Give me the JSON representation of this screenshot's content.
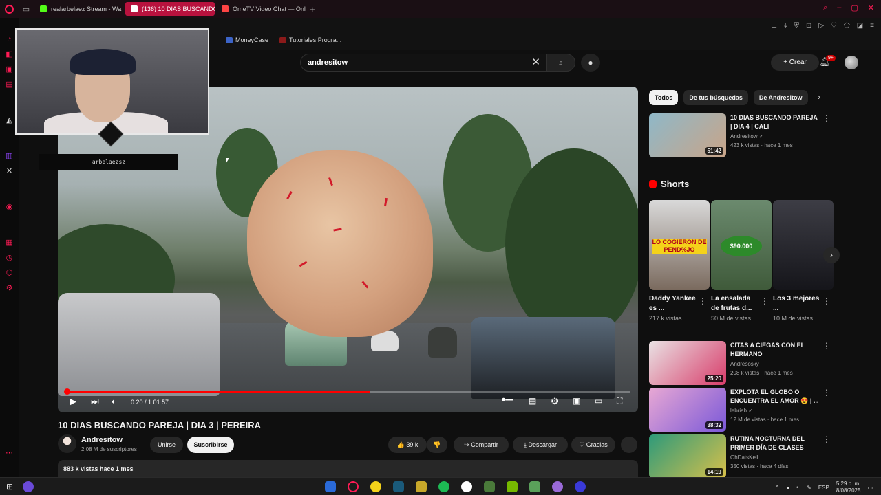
{
  "tabs": [
    {
      "title": "realarbelaez Stream - Wa",
      "color": "#53fc18"
    },
    {
      "title": "(136) 10 DIAS BUSCANDO",
      "color": "#ff0000"
    },
    {
      "title": "OmeTV Video Chat — Onl",
      "color": "#ff4444"
    }
  ],
  "new_tab": "+",
  "bookmarks": [
    {
      "label": "MoneyCase",
      "color": "#3c64c8"
    },
    {
      "label": "Tutoriales Progra...",
      "color": "#8b1a1a"
    }
  ],
  "search": {
    "query": "andresitow",
    "clear": "✕",
    "search_icon": "⌕",
    "mic_icon": "🎤"
  },
  "header": {
    "crear": "+ Crear",
    "notif_count": "9+"
  },
  "player": {
    "time": "0:20 / 1:01:57",
    "progress": 0.54
  },
  "video": {
    "title": "10 DIAS BUSCANDO PAREJA | DIA 3 | PEREIRA",
    "channel": "Andresitow",
    "subs": "2.08 M de suscriptores",
    "join": "Unirse",
    "subscribe": "Suscribirse",
    "likes": "👍 39 k",
    "dislike": "👎",
    "share": "↪ Compartir",
    "download": "⤓ Descargar",
    "thanks": "♡ Gracias",
    "more": "···",
    "views": "883 k vistas  hace 1 mes"
  },
  "webcam": {
    "label": "arbelaezsz"
  },
  "chips": [
    "Todos",
    "De tus búsquedas",
    "De Andresitow"
  ],
  "chips_next": "›",
  "recommended_top": {
    "title": "10 DIAS BUSCANDO PAREJA | DIA 4 | CALI",
    "channel": "Andresitow ✓",
    "meta": "423 k vistas · hace 1 mes",
    "duration": "51:42"
  },
  "shorts": {
    "heading": "Shorts",
    "items": [
      {
        "title": "Daddy Yankee es ...",
        "views": "217 k vistas",
        "thumb_text": "LO COGIERON DE PEND%JO"
      },
      {
        "title": "La ensalada de frutas d...",
        "views": "50 M de vistas",
        "thumb_text": "$90.000"
      },
      {
        "title": "Los 3 mejores ...",
        "views": "10 M de vistas",
        "thumb_text": ""
      }
    ],
    "next": "›"
  },
  "recommended": [
    {
      "title": "CITAS A CIEGAS CON EL HERMANO",
      "channel": "Andresosky",
      "meta": "208 k vistas · hace 1 mes",
      "duration": "25:20",
      "color": "#d83c6a"
    },
    {
      "title": "EXPLOTA EL GLOBO O ENCUENTRA EL AMOR 😍 | ...",
      "channel": "lebriah ✓",
      "meta": "12 M de vistas · hace 1 mes",
      "duration": "38:32",
      "color": "#7a58d8"
    },
    {
      "title": "RUTINA NOCTURNA DEL PRIMER DÍA DE CLASES",
      "channel": "OhDatsKell",
      "meta": "350 vistas · hace 4 días",
      "duration": "14:19",
      "color": "#2e9a7a"
    }
  ],
  "taskbar": {
    "lang": "ESP",
    "time": "5:29 p. m.",
    "date": "8/08/2025"
  },
  "colors": {
    "accent": "#ff1b55",
    "yt_red": "#ff0000"
  }
}
